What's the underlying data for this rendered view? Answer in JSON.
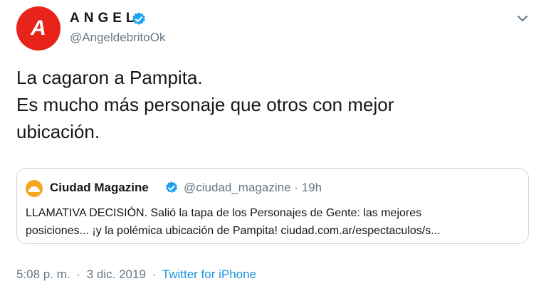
{
  "author": {
    "avatar_letter": "A",
    "name": "ANGEL",
    "handle": "@AngeldebritoOk",
    "verified_icon": "verified-badge-icon"
  },
  "tweet": {
    "lines": [
      "La cagaron a Pampita.",
      "Es mucho más personaje que otros con mejor",
      "ubicación."
    ]
  },
  "quoted": {
    "name": "Ciudad Magazine",
    "handle": "@ciudad_magazine",
    "dot": "·",
    "time": "19h",
    "lines": [
      "LLAMATIVA DECISIÓN. Salió la tapa de los Personajes de Gente: las mejores",
      "posiciones... ¡y la polémica ubicación de Pampita! ciudad.com.ar/espectaculos/s..."
    ]
  },
  "footer": {
    "time": "5:08 p. m.",
    "dot": "·",
    "date": "3 dic. 2019",
    "dot2": "·",
    "source": "Twitter for iPhone"
  },
  "colors": {
    "avatar_bg": "#e8231a",
    "verified": "#1da1f2",
    "link": "#1b95e0",
    "muted": "#657786"
  }
}
